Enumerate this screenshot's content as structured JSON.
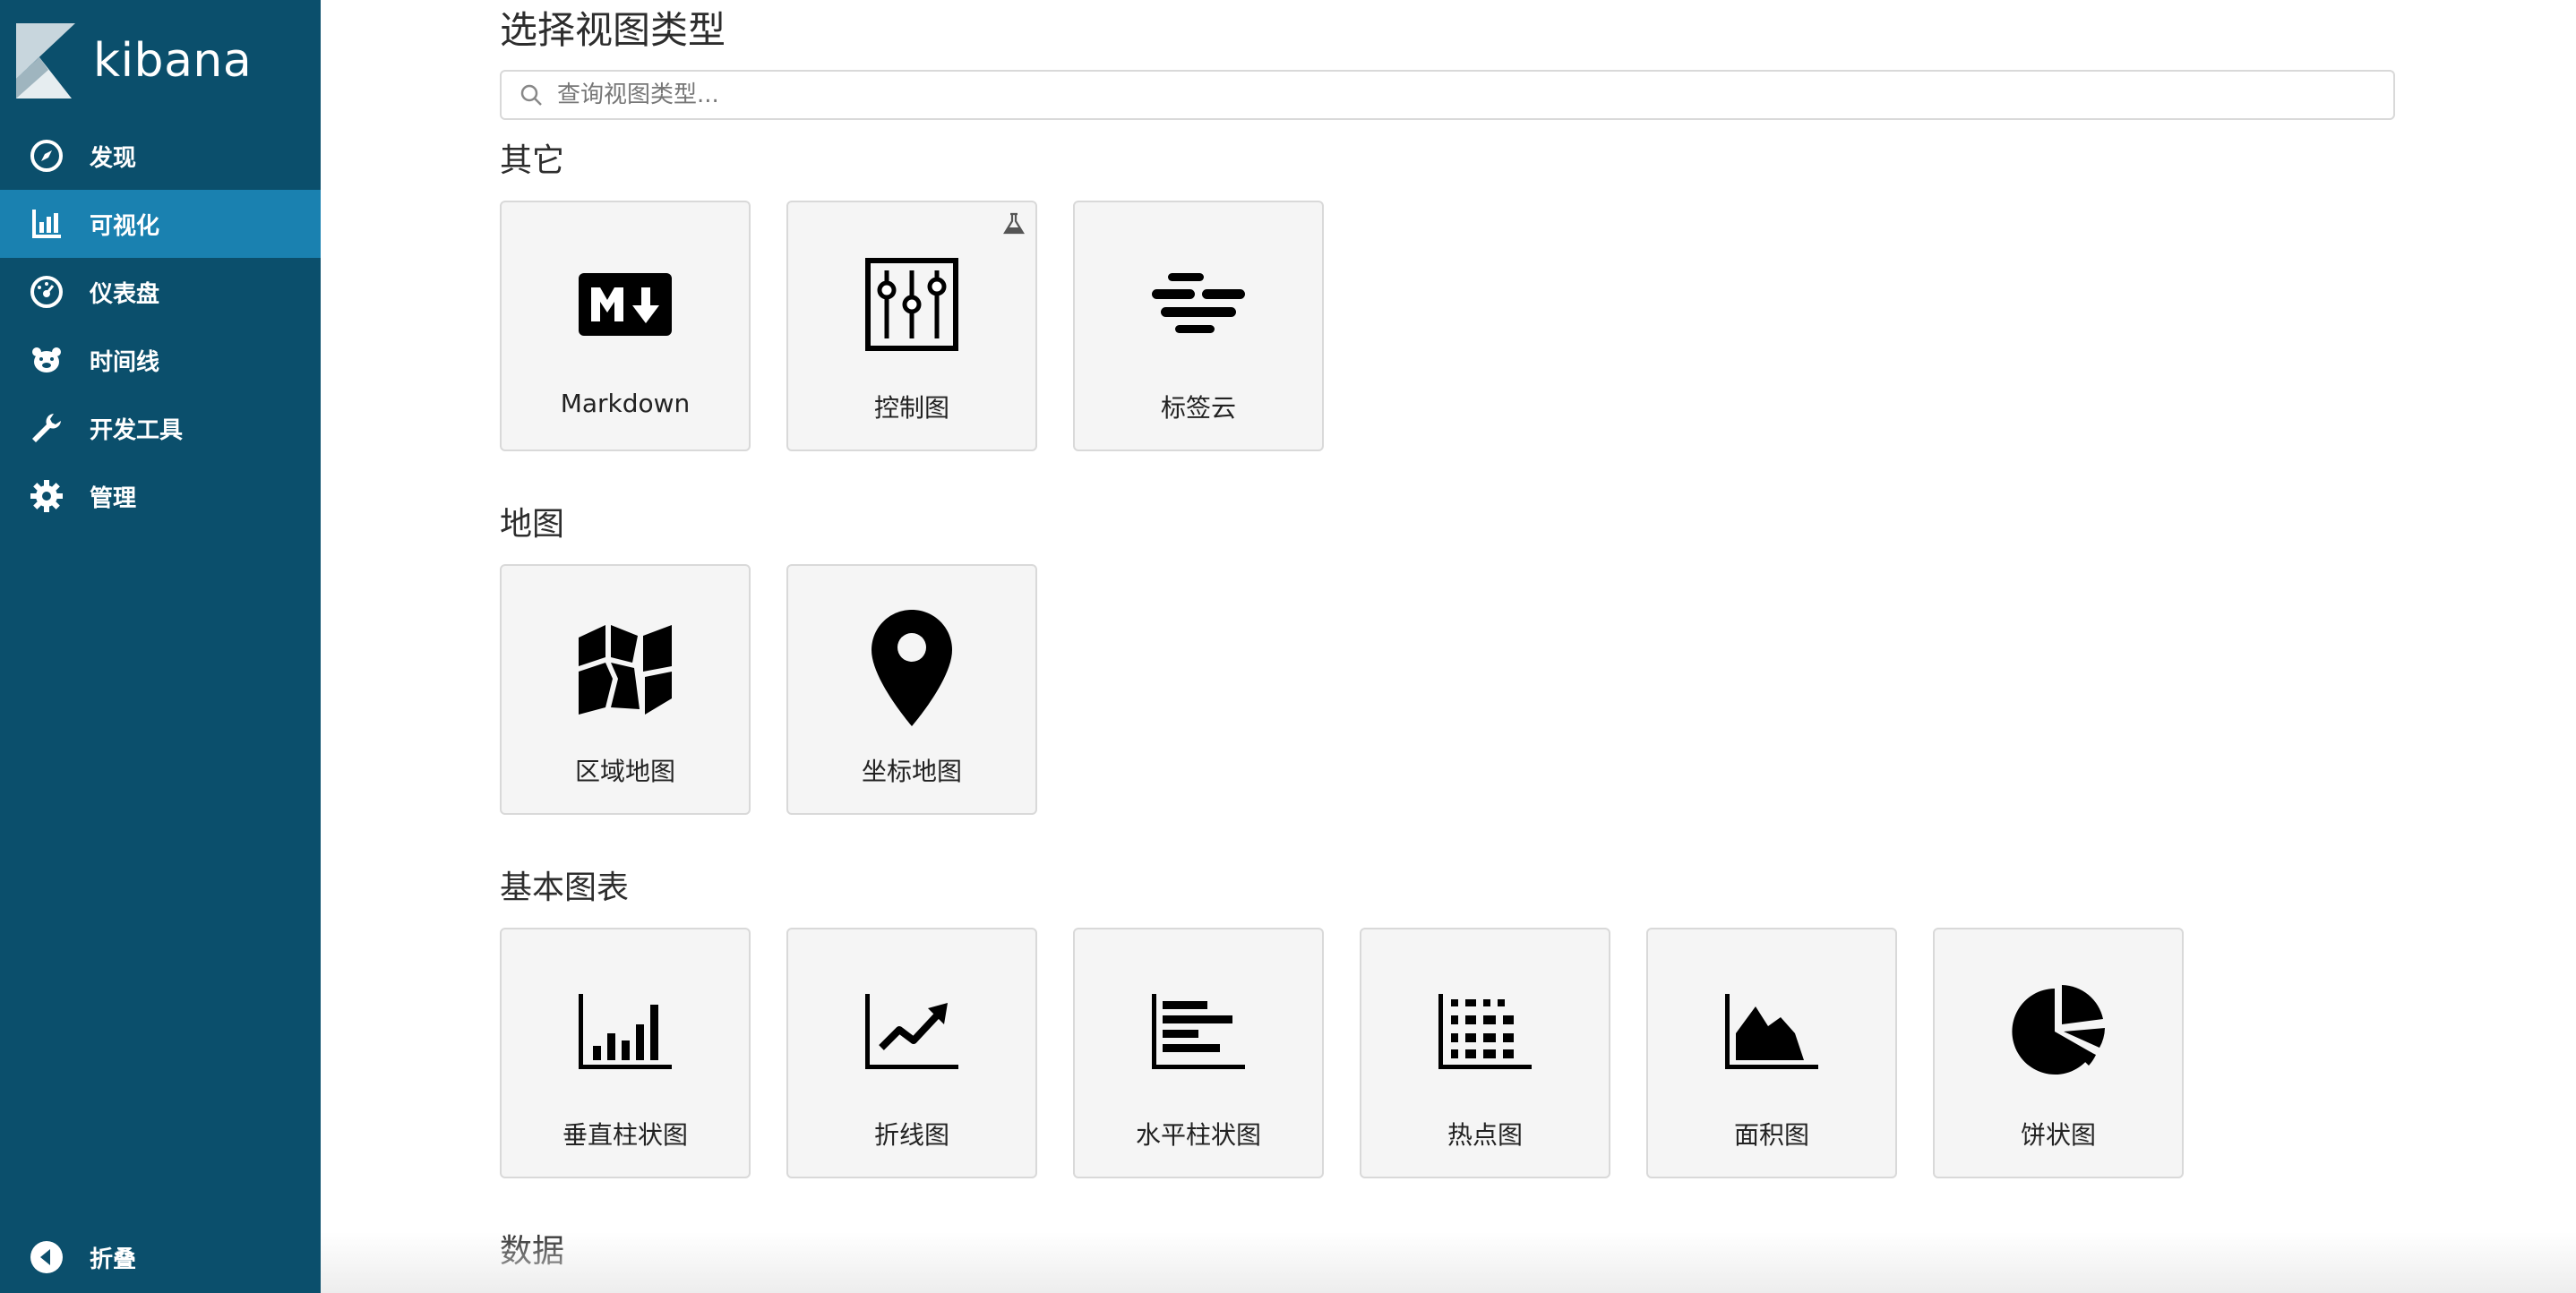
{
  "app": {
    "logo_text": "kibana"
  },
  "sidebar": {
    "items": [
      {
        "label": "发现",
        "icon": "compass-icon"
      },
      {
        "label": "可视化",
        "icon": "bar-chart-icon"
      },
      {
        "label": "仪表盘",
        "icon": "dashboard-gauge-icon"
      },
      {
        "label": "时间线",
        "icon": "timelion-bear-icon"
      },
      {
        "label": "开发工具",
        "icon": "wrench-icon"
      },
      {
        "label": "管理",
        "icon": "gear-icon"
      }
    ],
    "active_index": 1,
    "collapse_label": "折叠",
    "bg_color": "#0b4f6c",
    "active_color": "#1a81b0"
  },
  "main": {
    "title": "选择视图类型",
    "search_placeholder": "查询视图类型..."
  },
  "sections": [
    {
      "title": "其它",
      "cards": [
        {
          "label": "Markdown",
          "icon": "markdown-icon"
        },
        {
          "label": "控制图",
          "icon": "controls-sliders-icon",
          "experimental": true
        },
        {
          "label": "标签云",
          "icon": "tag-cloud-icon"
        }
      ]
    },
    {
      "title": "地图",
      "cards": [
        {
          "label": "区域地图",
          "icon": "region-map-icon"
        },
        {
          "label": "坐标地图",
          "icon": "map-pin-icon"
        }
      ]
    },
    {
      "title": "基本图表",
      "cards": [
        {
          "label": "垂直柱状图",
          "icon": "vertical-bar-icon"
        },
        {
          "label": "折线图",
          "icon": "line-chart-icon"
        },
        {
          "label": "水平柱状图",
          "icon": "horizontal-bar-icon"
        },
        {
          "label": "热点图",
          "icon": "heatmap-icon"
        },
        {
          "label": "面积图",
          "icon": "area-chart-icon"
        },
        {
          "label": "饼状图",
          "icon": "pie-chart-icon"
        }
      ]
    },
    {
      "title": "数据",
      "cards": []
    }
  ]
}
